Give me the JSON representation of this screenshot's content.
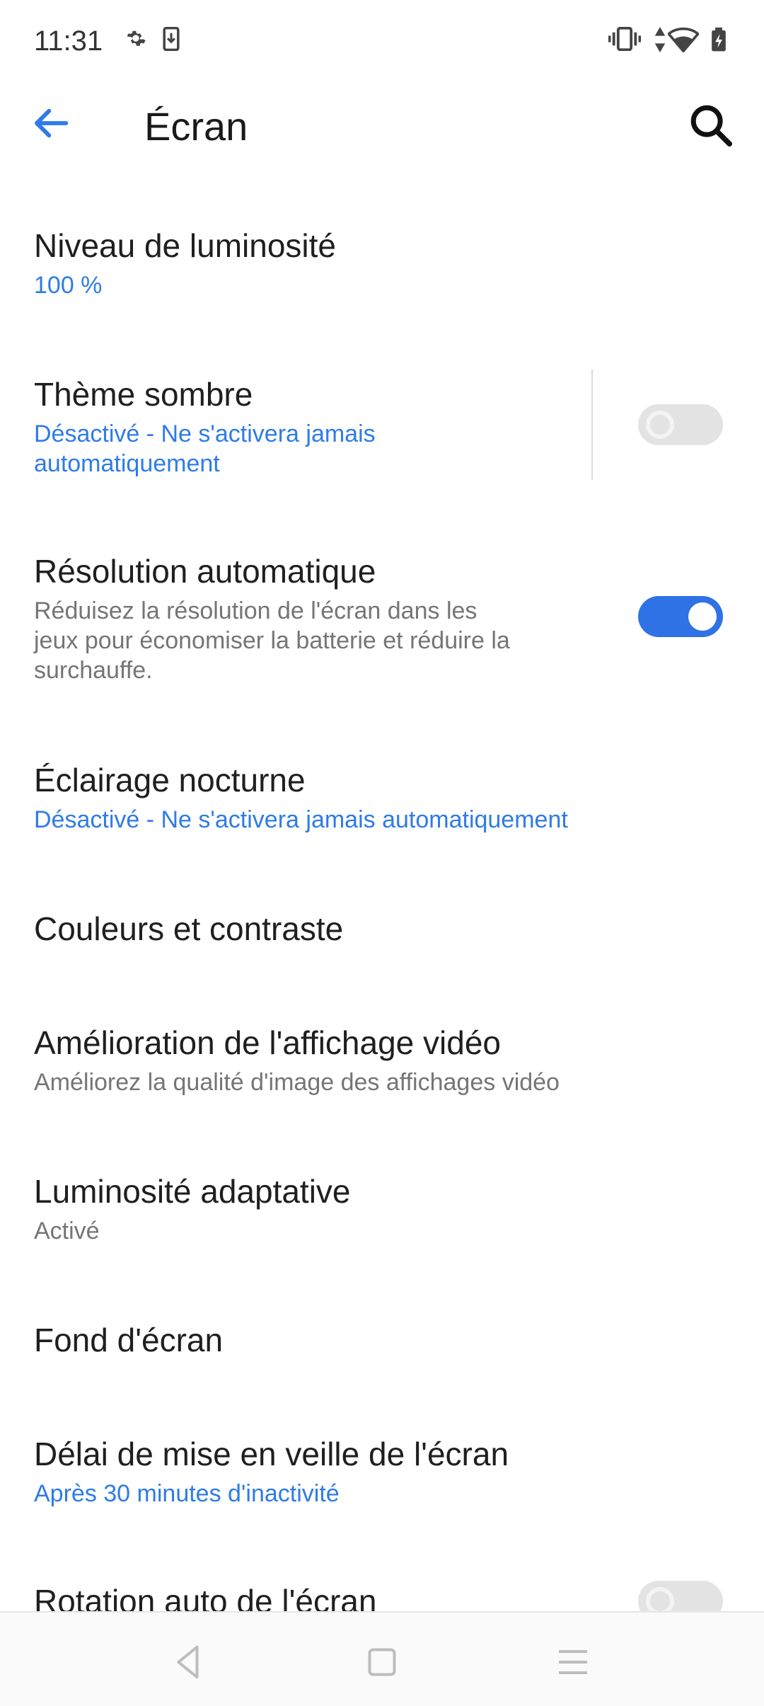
{
  "status_bar": {
    "time": "11:31",
    "icons_left": [
      "gear-icon",
      "download-icon"
    ],
    "icons_right": [
      "vibrate-icon",
      "data-arrows-icon",
      "wifi-icon",
      "battery-charging-icon"
    ]
  },
  "header": {
    "title": "Écran",
    "back_icon": "arrow-back-icon",
    "search_icon": "search-icon"
  },
  "settings": {
    "brightness": {
      "title": "Niveau de luminosité",
      "value": "100 %"
    },
    "dark_theme": {
      "title": "Thème sombre",
      "subtitle_line1": "Désactivé - Ne s'activera jamais",
      "subtitle_line2": "automatiquement",
      "enabled": false
    },
    "auto_resolution": {
      "title": "Résolution automatique",
      "subtitle_line1": "Réduisez la résolution de l'écran dans les",
      "subtitle_line2": "jeux pour économiser la batterie et réduire la",
      "subtitle_line3": "surchauffe.",
      "enabled": true
    },
    "night_light": {
      "title": "Éclairage nocturne",
      "subtitle": "Désactivé - Ne s'activera jamais automatiquement"
    },
    "colors": {
      "title": "Couleurs et contraste"
    },
    "video_enhance": {
      "title": "Amélioration de l'affichage vidéo",
      "subtitle": "Améliorez la qualité d'image des affichages vidéo"
    },
    "adaptive_brightness": {
      "title": "Luminosité adaptative",
      "subtitle": "Activé"
    },
    "wallpaper": {
      "title": "Fond d'écran"
    },
    "sleep_timeout": {
      "title": "Délai de mise en veille de l'écran",
      "subtitle": "Après 30 minutes d'inactivité"
    },
    "auto_rotate": {
      "title": "Rotation auto de l'écran",
      "enabled": false
    }
  },
  "nav_bar": {
    "icons": [
      "back-triangle-icon",
      "home-square-icon",
      "menu-lines-icon"
    ]
  },
  "colors": {
    "accent": "#2f7be8",
    "toggle_on": "#2f72e6",
    "toggle_off": "#e3e3e3"
  }
}
